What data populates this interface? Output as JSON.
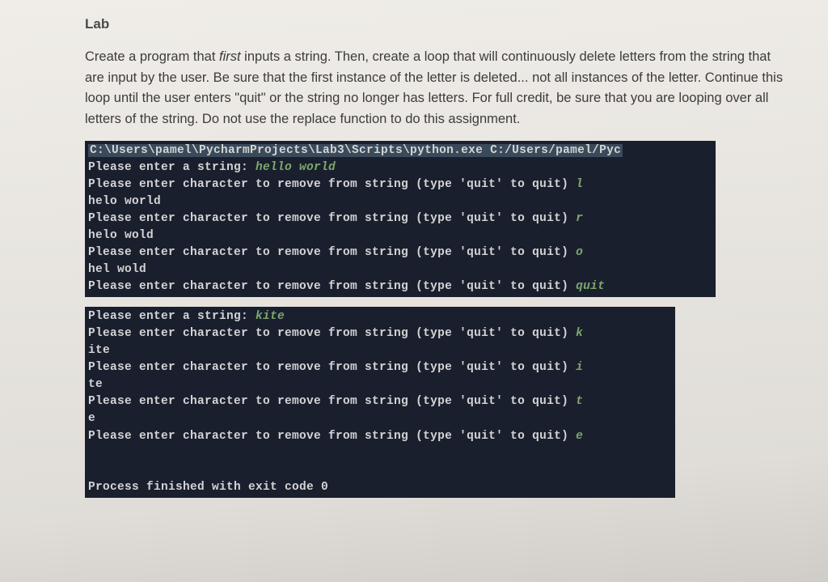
{
  "title": "Lab",
  "instructions": "Create a program that first inputs a string.  Then, create a loop that will continuously delete letters from the string that are input by the user.  Be sure that the first instance of the letter is deleted... not all instances of the letter. Continue this loop until the user enters \"quit\" or the string no longer has letters. For full credit, be sure that you are looping over all letters of the string.  Do not use the replace function to do this assignment.",
  "emphasized_word": "first",
  "terminal1": {
    "path_line": "C:\\Users\\pamel\\PycharmProjects\\Lab3\\Scripts\\python.exe C:/Users/pamel/Pyc",
    "lines": [
      {
        "prompt": "Please enter a string: ",
        "input": "hello world"
      },
      {
        "prompt": "Please enter character to remove from string (type 'quit' to quit) ",
        "input": "l"
      },
      {
        "output": "helo world"
      },
      {
        "prompt": "Please enter character to remove from string (type 'quit' to quit) ",
        "input": "r"
      },
      {
        "output": "helo wold"
      },
      {
        "prompt": "Please enter character to remove from string (type 'quit' to quit) ",
        "input": "o"
      },
      {
        "output": "hel wold"
      },
      {
        "prompt": "Please enter character to remove from string (type 'quit' to quit) ",
        "input": "quit"
      }
    ]
  },
  "terminal2": {
    "lines": [
      {
        "prompt": "Please enter a string: ",
        "input": "kite"
      },
      {
        "prompt": "Please enter character to remove from string (type 'quit' to quit) ",
        "input": "k"
      },
      {
        "output": "ite"
      },
      {
        "prompt": "Please enter character to remove from string (type 'quit' to quit) ",
        "input": "i"
      },
      {
        "output": "te"
      },
      {
        "prompt": "Please enter character to remove from string (type 'quit' to quit) ",
        "input": "t"
      },
      {
        "output": "e"
      },
      {
        "prompt": "Please enter character to remove from string (type 'quit' to quit) ",
        "input": "e"
      },
      {
        "blank": true
      },
      {
        "blank": true
      },
      {
        "output": "Process finished with exit code 0"
      }
    ]
  }
}
